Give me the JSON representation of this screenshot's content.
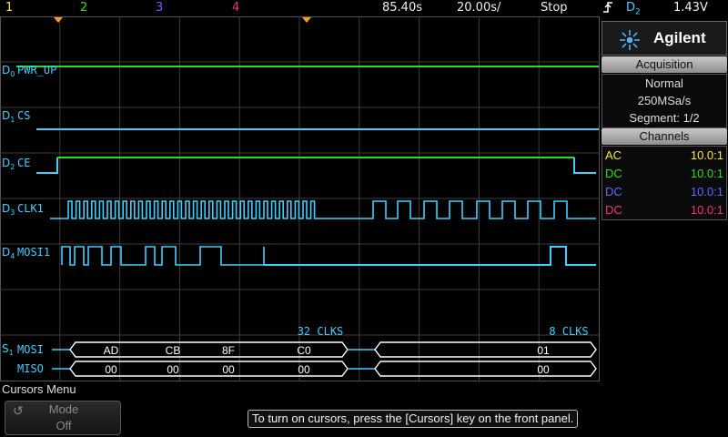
{
  "status_bar": {
    "channels": [
      "1",
      "2",
      "3",
      "4"
    ],
    "delay": "85.40s",
    "timebase": "20.00s/",
    "run_state": "Stop",
    "trigger_icon": "trigger-edge-icon",
    "trigger_source": "D2",
    "trigger_level": "1.43V"
  },
  "digital_channels": [
    {
      "id": "D0",
      "label": "PWR_UP"
    },
    {
      "id": "D1",
      "label": "CS"
    },
    {
      "id": "D2",
      "label": "CE"
    },
    {
      "id": "D3",
      "label": "CLK1"
    },
    {
      "id": "D4",
      "label": "MOSI1"
    }
  ],
  "serial_bus": {
    "id": "S1",
    "rows": [
      {
        "label": "MOSI",
        "frames": [
          "AD",
          "CB",
          "8F",
          "C0"
        ],
        "frame2": "01"
      },
      {
        "label": "MISO",
        "frames": [
          "00",
          "00",
          "00",
          "00"
        ],
        "frame2": "00"
      }
    ],
    "annotations": [
      "32 CLKS",
      "8 CLKS"
    ]
  },
  "panel": {
    "brand": "Agilent",
    "acquisition_title": "Acquisition",
    "acquisition": [
      "Normal",
      "250MSa/s",
      "Segment: 1/2"
    ],
    "channels_title": "Channels",
    "channels": [
      {
        "coupling": "AC",
        "probe": "10.0:1",
        "color": "#f6e64a"
      },
      {
        "coupling": "DC",
        "probe": "10.0:1",
        "color": "#26e01e"
      },
      {
        "coupling": "DC",
        "probe": "10.0:1",
        "color": "#5a6bff"
      },
      {
        "coupling": "DC",
        "probe": "10.0:1",
        "color": "#f0307a"
      }
    ]
  },
  "menu": {
    "title": "Cursors Menu",
    "softkey_icon": "rotate-knob-icon",
    "softkey_name": "Mode",
    "softkey_value": "Off",
    "hint": "To turn on cursors, press the [Cursors] key on the front panel."
  },
  "colors": {
    "trace": "#3fd0ff",
    "trace_high": "#26e01e",
    "grid": "#3c3c3c",
    "marker": "#ff9a1a"
  }
}
